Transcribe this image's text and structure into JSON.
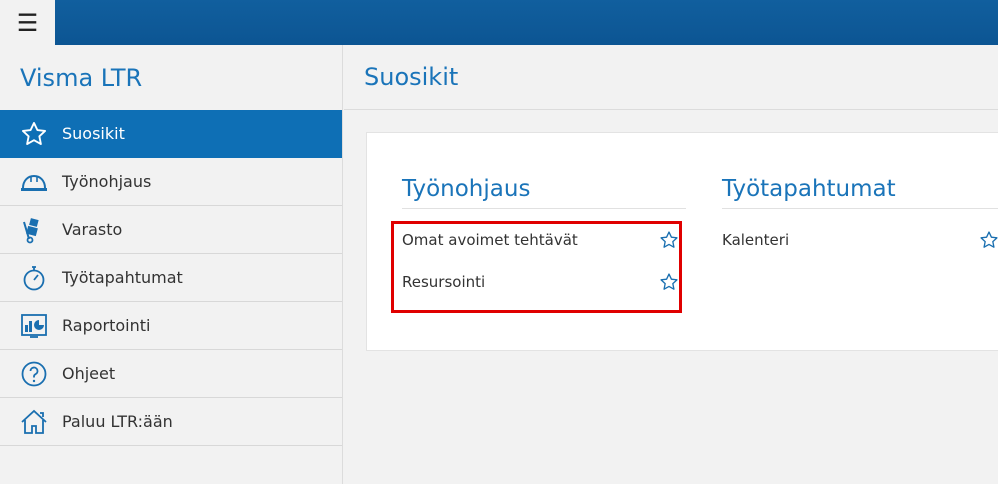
{
  "header": {
    "menu_glyph": "☰"
  },
  "sidebar": {
    "app_title": "Visma LTR",
    "items": [
      {
        "label": "Suosikit",
        "icon": "star-icon",
        "active": true
      },
      {
        "label": "Työnohjaus",
        "icon": "helmet-icon",
        "active": false
      },
      {
        "label": "Varasto",
        "icon": "hand-truck-icon",
        "active": false
      },
      {
        "label": "Työtapahtumat",
        "icon": "stopwatch-icon",
        "active": false
      },
      {
        "label": "Raportointi",
        "icon": "report-chart-icon",
        "active": false
      },
      {
        "label": "Ohjeet",
        "icon": "help-circle-icon",
        "active": false
      },
      {
        "label": "Paluu LTR:ään",
        "icon": "home-icon",
        "active": false
      }
    ]
  },
  "main": {
    "page_title": "Suosikit",
    "sections": [
      {
        "title": "Työnohjaus",
        "links": [
          "Omat avoimet tehtävät",
          "Resursointi"
        ]
      },
      {
        "title": "Työtapahtumat",
        "links": [
          "Kalenteri"
        ]
      }
    ]
  },
  "colors": {
    "brand_blue": "#0e6fb5",
    "title_blue": "#1a74b9",
    "highlight_red": "#e00000"
  }
}
